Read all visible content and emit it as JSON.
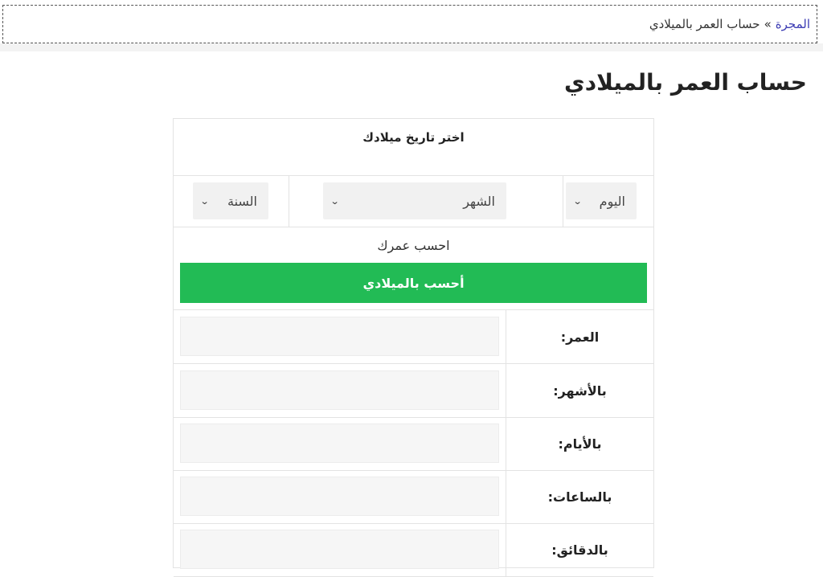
{
  "breadcrumb": {
    "home_label": "المجرة",
    "separator": "»",
    "current_label": "حساب العمر بالميلادي"
  },
  "page_title": "حساب العمر بالميلادي",
  "form": {
    "header": "اختر تاريخ ميلادك",
    "day_select": "اليوم",
    "month_select": "الشهر",
    "year_select": "السنة",
    "submit_caption": "احسب عمرك",
    "submit_button": "أحسب بالميلادي"
  },
  "results": [
    {
      "label": "العمر:",
      "value": ""
    },
    {
      "label": "بالأشهر:",
      "value": ""
    },
    {
      "label": "بالأيام:",
      "value": ""
    },
    {
      "label": "بالساعات:",
      "value": ""
    },
    {
      "label": "بالدقائق:",
      "value": ""
    }
  ],
  "colors": {
    "button_green": "#22bb55",
    "link_blue": "#3b3bb3",
    "field_gray": "#f6f6f6"
  },
  "icons": {
    "dropdown": "chevron-down-icon"
  }
}
